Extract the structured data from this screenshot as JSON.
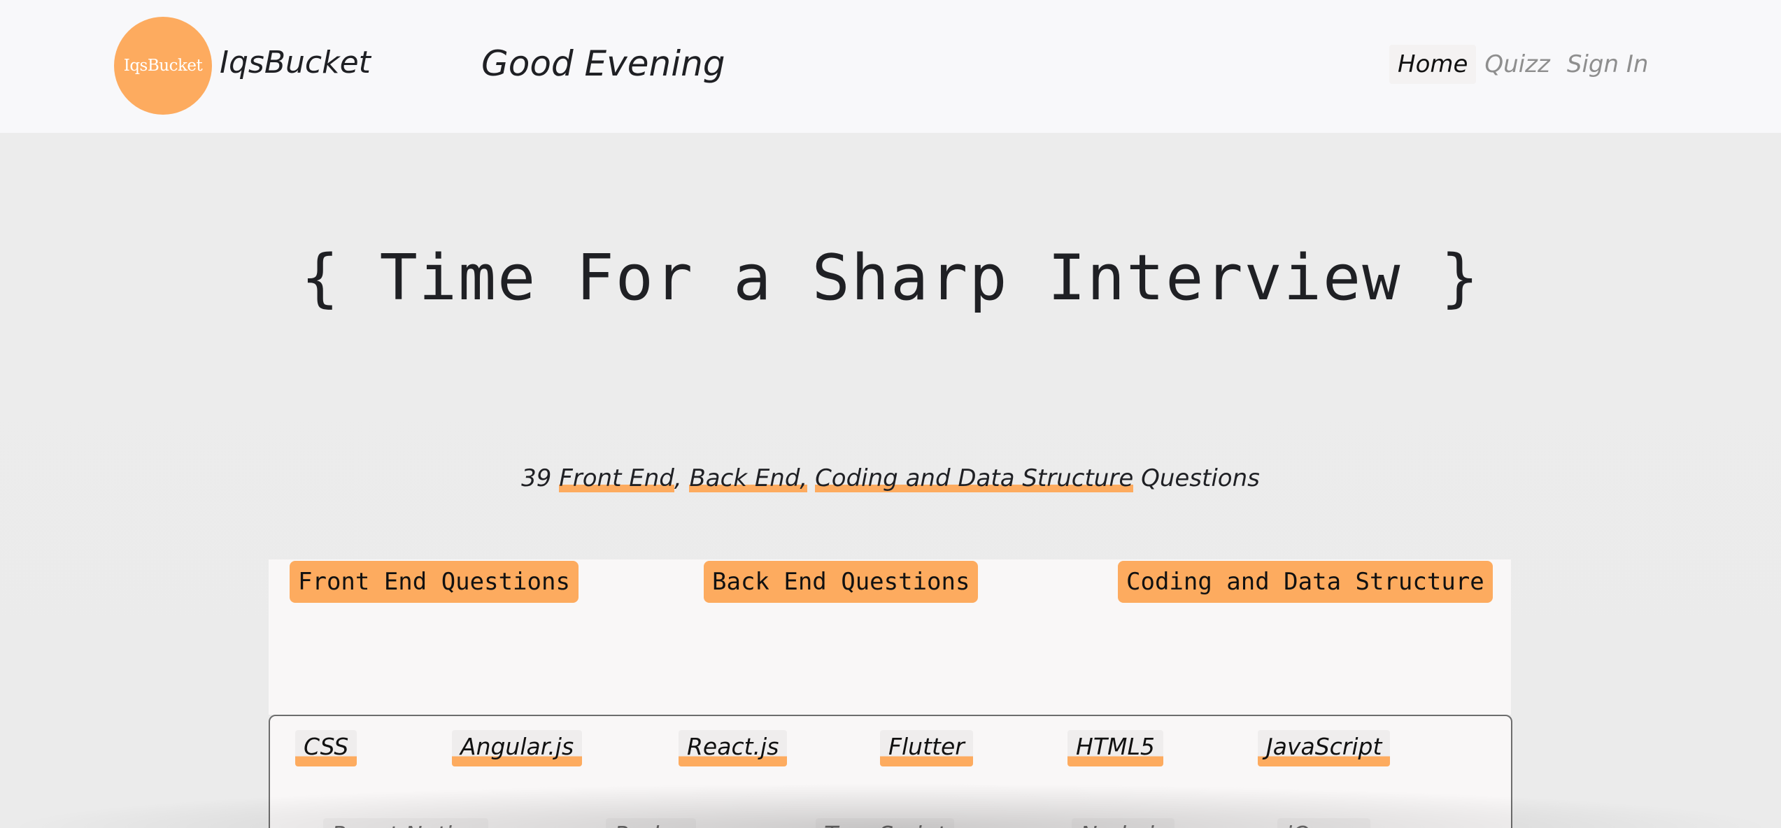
{
  "header": {
    "logo_text": "IqsBucket",
    "brand_name": "IqsBucket",
    "greeting": "Good Evening",
    "nav": [
      {
        "label": "Home",
        "active": true
      },
      {
        "label": "Quizz",
        "active": false
      },
      {
        "label": "Sign In",
        "active": false
      }
    ]
  },
  "hero": {
    "title": "{ Time For a Sharp Interview }",
    "subtitle": {
      "count": "39",
      "front_end": "Front End",
      "sep1": ",",
      "back_end": "Back End,",
      "coding": "Coding and Data Structure",
      "suffix": "Questions"
    }
  },
  "categories": [
    {
      "label": "Front End Questions"
    },
    {
      "label": "Back End Questions"
    },
    {
      "label": "Coding and Data Structure"
    }
  ],
  "topics": [
    {
      "label": "CSS"
    },
    {
      "label": "Angular.js"
    },
    {
      "label": "React.js"
    },
    {
      "label": "Flutter"
    },
    {
      "label": "HTML5"
    },
    {
      "label": "JavaScript"
    }
  ],
  "topics_row2": [
    {
      "label": "React Native"
    },
    {
      "label": "Redux"
    },
    {
      "label": "TypeScript"
    },
    {
      "label": "Node.js"
    },
    {
      "label": "jQuery"
    }
  ],
  "colors": {
    "accent": "#fdab5f",
    "header_bg": "#f8f8fa",
    "page_bg": "#ececec",
    "text": "#1f2024",
    "nav_inactive": "#8e8e8e"
  }
}
